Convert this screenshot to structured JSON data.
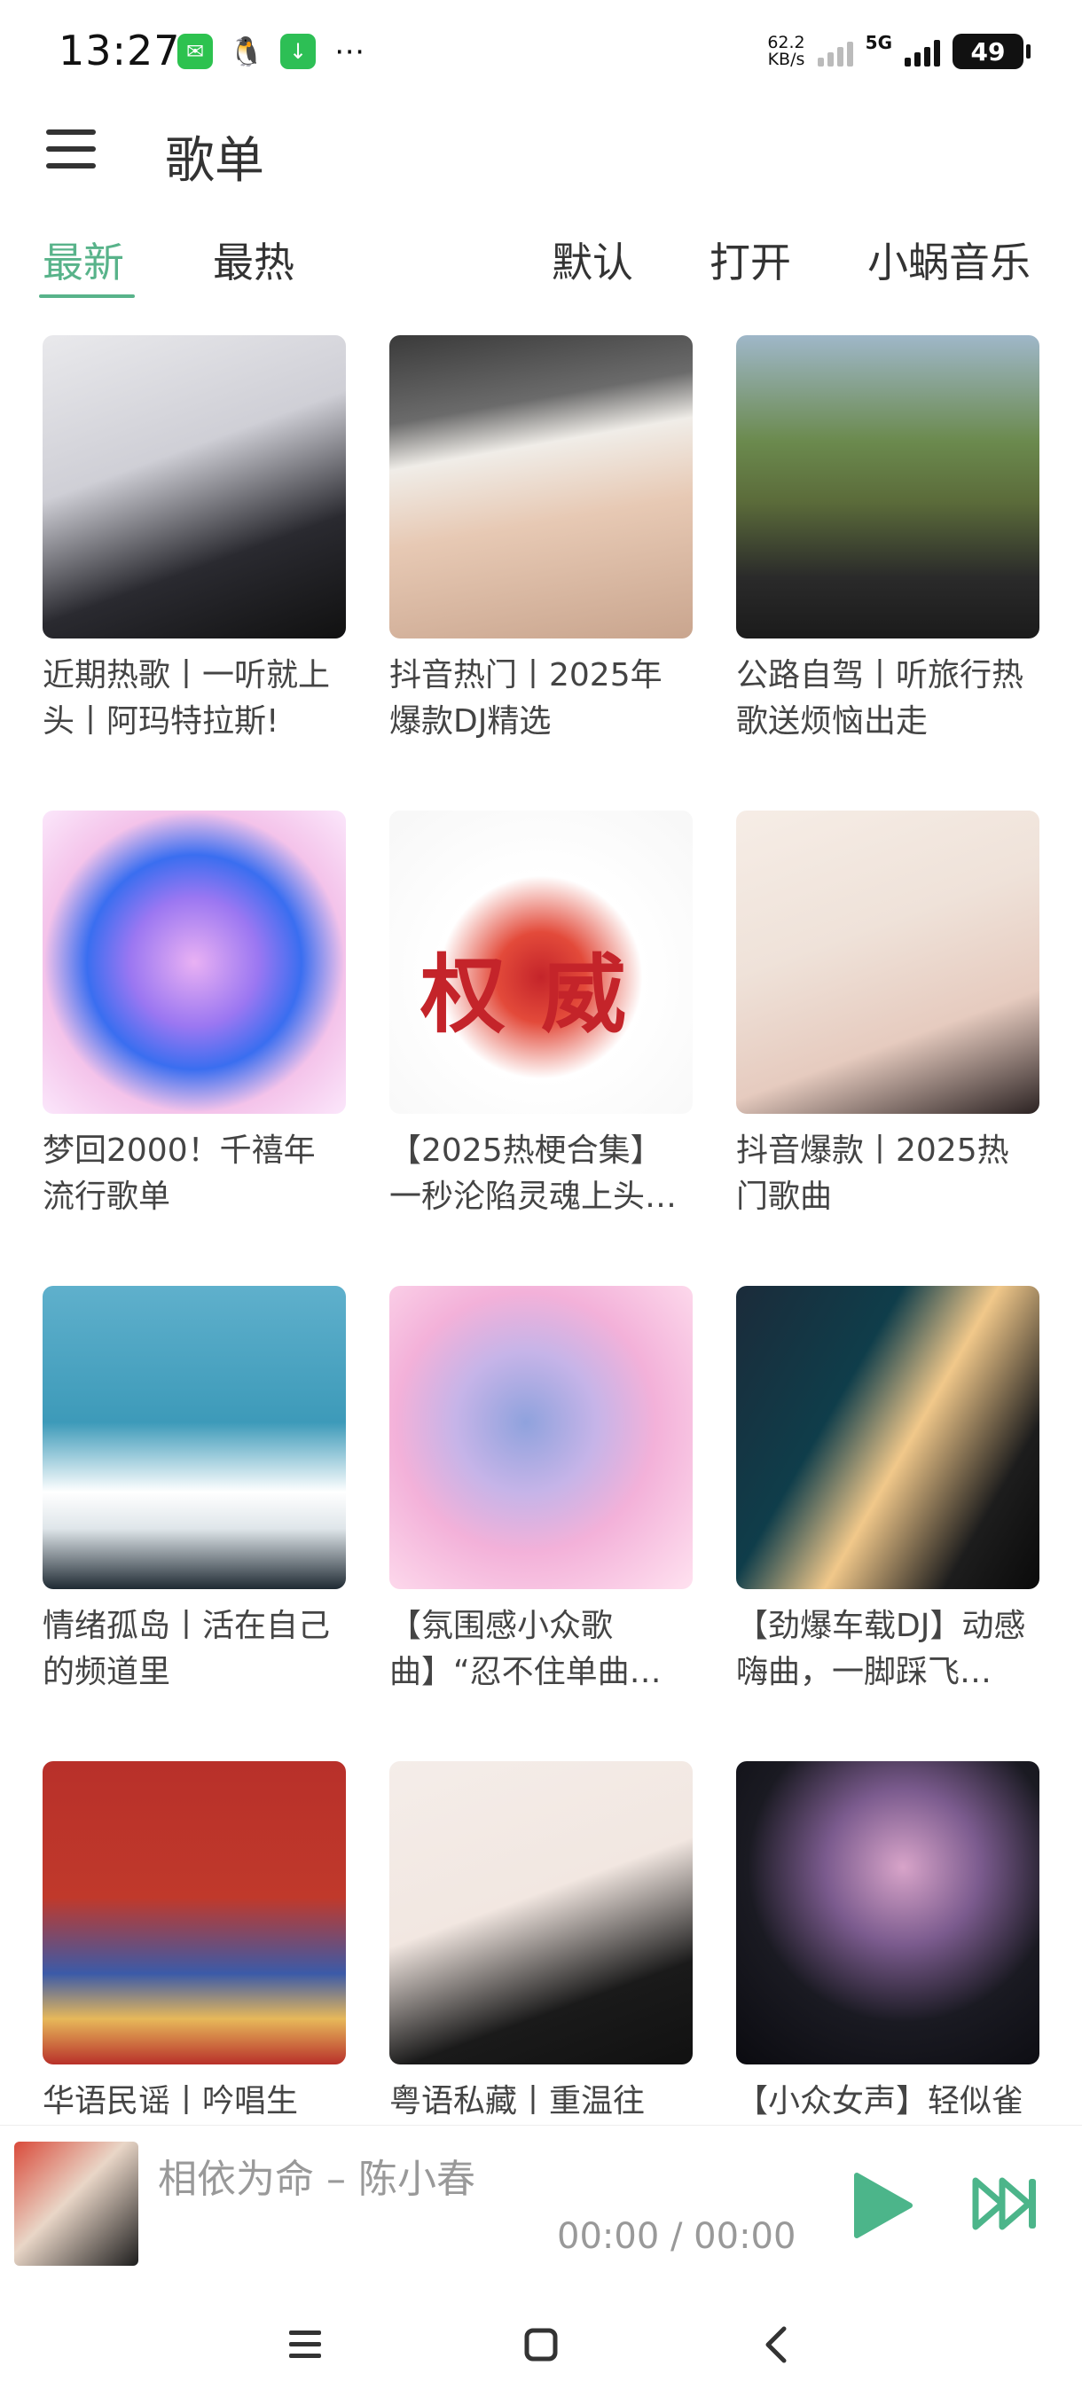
{
  "status_bar": {
    "time": "13:27",
    "left_icons": [
      "wechat-icon",
      "qq-icon",
      "download-icon",
      "more-icon"
    ],
    "net_speed_value": "62.2",
    "net_speed_unit": "KB/s",
    "network": "5G",
    "battery": "49"
  },
  "header": {
    "title": "歌单"
  },
  "tabs": {
    "items": [
      "最新",
      "最热",
      "默认",
      "打开",
      "小蜗音乐"
    ],
    "active_color": "#58b38a"
  },
  "playlists": [
    {
      "title": "近期热歌丨一听就上头丨阿玛特拉斯!"
    },
    {
      "title": "抖音热门丨2025年爆款DJ精选"
    },
    {
      "title": "公路自驾丨听旅行热歌送烦恼出走"
    },
    {
      "title": "梦回2000！千禧年流行歌单"
    },
    {
      "title": "【2025热梗合集】一秒沦陷灵魂上头…",
      "cover_text": "权威"
    },
    {
      "title": "抖音爆款丨2025热门歌曲"
    },
    {
      "title": "情绪孤岛丨活在自己的频道里"
    },
    {
      "title": "【氛围感小众歌曲】“忍不住单曲循环！”"
    },
    {
      "title": "【劲爆车载DJ】动感嗨曲，一脚踩飞…"
    },
    {
      "title": "华语民谣丨吟唱生"
    },
    {
      "title": "粤语私藏丨重温往"
    },
    {
      "title": "【小众女声】轻似雀"
    }
  ],
  "player": {
    "song_title": "相依为命 – 陈小春",
    "time": "00:00 / 00:00",
    "accent_color": "#4cb58a"
  },
  "nav": {
    "icons": [
      "menu-icon",
      "home-icon",
      "back-icon"
    ]
  }
}
